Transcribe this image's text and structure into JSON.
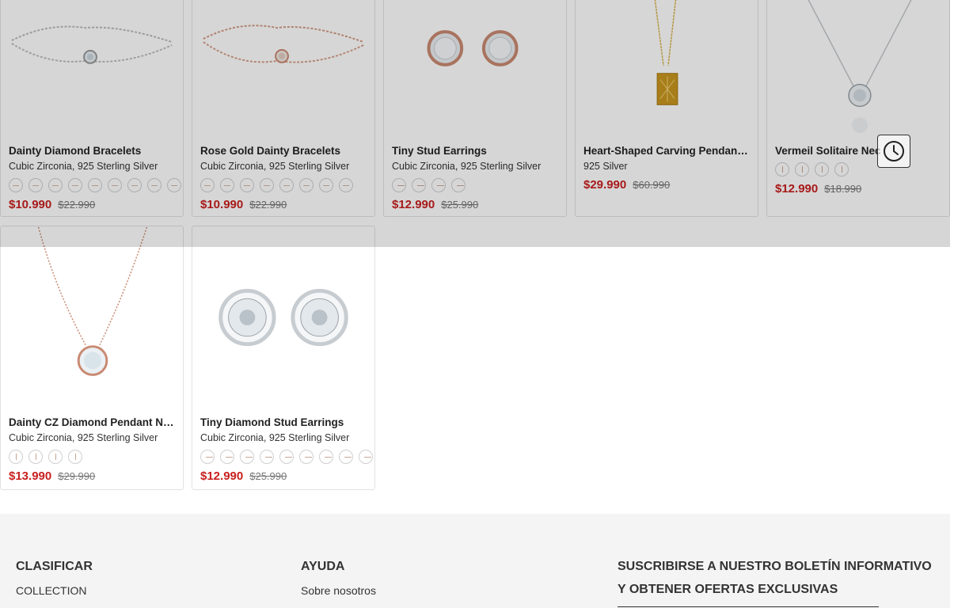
{
  "products": [
    {
      "title": "Dainty Diamond Bracelets",
      "subtitle": "Cubic Zirconia, 925 Sterling Silver",
      "price": "$10.990",
      "old_price": "$22.990",
      "swatch_count": 9,
      "swatch_style": "line",
      "image": "silver-bracelet"
    },
    {
      "title": "Rose Gold Dainty Bracelets",
      "subtitle": "Cubic Zirconia, 925 Sterling Silver",
      "price": "$10.990",
      "old_price": "$22.990",
      "swatch_count": 8,
      "swatch_style": "line",
      "image": "rose-gold-bracelet"
    },
    {
      "title": "Tiny Stud Earrings",
      "subtitle": "Cubic Zirconia, 925 Sterling Silver",
      "price": "$12.990",
      "old_price": "$25.990",
      "swatch_count": 4,
      "swatch_style": "dot",
      "image": "rose-stud-earrings"
    },
    {
      "title": "Heart-Shaped Carving Pendant …",
      "subtitle": "925 Silver",
      "price": "$29.990",
      "old_price": "$60.990",
      "swatch_count": 0,
      "swatch_style": "none",
      "image": "gold-tag-necklace"
    },
    {
      "title": "Vermeil Solitaire Nec",
      "subtitle": "",
      "price": "$12.990",
      "old_price": "$18.990",
      "swatch_count": 4,
      "swatch_style": "pend",
      "image": "silver-solitaire-necklace"
    },
    {
      "title": "Dainty CZ Diamond Pendant Ne…",
      "subtitle": "Cubic Zirconia, 925 Sterling Silver",
      "price": "$13.990",
      "old_price": "$29.990",
      "swatch_count": 4,
      "swatch_style": "pend",
      "image": "rose-pendant-necklace"
    },
    {
      "title": "Tiny Diamond Stud Earrings",
      "subtitle": "Cubic Zirconia, 925 Sterling Silver",
      "price": "$12.990",
      "old_price": "$25.990",
      "swatch_count": 9,
      "swatch_style": "dot",
      "image": "silver-stud-earrings"
    }
  ],
  "history_button": {
    "icon": "clock-icon"
  },
  "footer": {
    "col1": {
      "heading": "CLASIFICAR",
      "link1": "COLLECTION"
    },
    "col2": {
      "heading": "AYUDA",
      "link1": "Sobre nosotros"
    },
    "newsletter": {
      "heading": "SUSCRIBIRSE A NUESTRO BOLETÍN INFORMATIVO Y OBTENER OFERTAS EXCLUSIVAS"
    }
  },
  "colors": {
    "price": "#c8201e",
    "footer_bg": "#f4f4f4",
    "overlay": "rgba(0,0,0,0.16)"
  }
}
